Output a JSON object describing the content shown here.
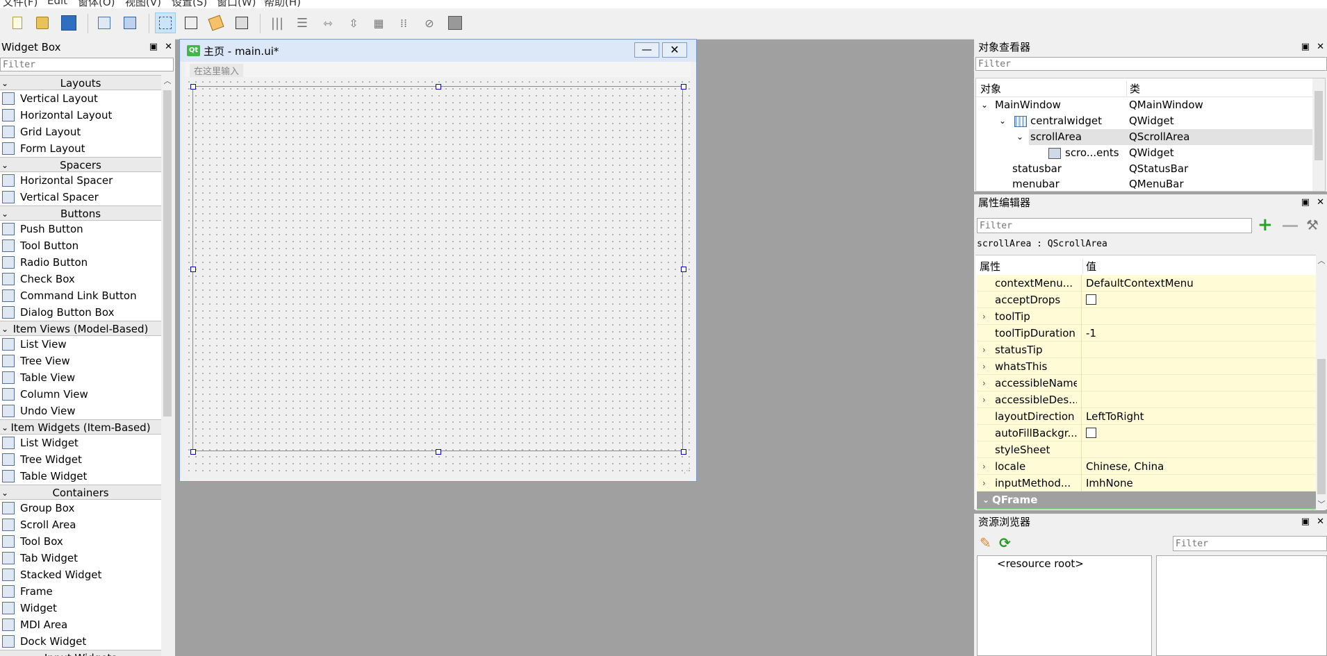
{
  "menu": [
    "文件(F)",
    "Edit",
    "窗体(O)",
    "视图(V)",
    "设置(S)",
    "窗口(W)",
    "帮助(H)"
  ],
  "widget_box": {
    "title": "Widget Box",
    "filter_placeholder": "Filter",
    "categories": [
      {
        "name": "Layouts",
        "items": [
          "Vertical Layout",
          "Horizontal Layout",
          "Grid Layout",
          "Form Layout"
        ]
      },
      {
        "name": "Spacers",
        "items": [
          "Horizontal Spacer",
          "Vertical Spacer"
        ]
      },
      {
        "name": "Buttons",
        "items": [
          "Push Button",
          "Tool Button",
          "Radio Button",
          "Check Box",
          "Command Link Button",
          "Dialog Button Box"
        ]
      },
      {
        "name": "Item Views (Model-Based)",
        "items": [
          "List View",
          "Tree View",
          "Table View",
          "Column View",
          "Undo View"
        ]
      },
      {
        "name": "Item Widgets (Item-Based)",
        "items": [
          "List Widget",
          "Tree Widget",
          "Table Widget"
        ]
      },
      {
        "name": "Containers",
        "items": [
          "Group Box",
          "Scroll Area",
          "Tool Box",
          "Tab Widget",
          "Stacked Widget",
          "Frame",
          "Widget",
          "MDI Area",
          "Dock Widget"
        ]
      }
    ],
    "partial_next": "Input Widgets"
  },
  "form": {
    "title": "主页 - main.ui*",
    "qt_badge": "Qt",
    "menu_placeholder": "在这里输入"
  },
  "object_inspector": {
    "title": "对象查看器",
    "filter_placeholder": "Filter",
    "col_object": "对象",
    "col_class": "类",
    "rows": [
      {
        "name": "MainWindow",
        "cls": "QMainWindow"
      },
      {
        "name": "centralwidget",
        "cls": "QWidget"
      },
      {
        "name": "scrollArea",
        "cls": "QScrollArea"
      },
      {
        "name": "scro...ents",
        "cls": "QWidget"
      },
      {
        "name": "statusbar",
        "cls": "QStatusBar"
      },
      {
        "name": "menubar",
        "cls": "QMenuBar"
      }
    ]
  },
  "property_editor": {
    "title": "属性编辑器",
    "filter_placeholder": "Filter",
    "context": "scrollArea : QScrollArea",
    "col_prop": "属性",
    "col_value": "值",
    "rows": [
      {
        "name": "contextMenu...",
        "value": "DefaultContextMenu"
      },
      {
        "name": "acceptDrops",
        "value": ""
      },
      {
        "name": "toolTip",
        "value": ""
      },
      {
        "name": "toolTipDuration",
        "value": "-1"
      },
      {
        "name": "statusTip",
        "value": ""
      },
      {
        "name": "whatsThis",
        "value": ""
      },
      {
        "name": "accessibleName",
        "value": ""
      },
      {
        "name": "accessibleDes...",
        "value": ""
      },
      {
        "name": "layoutDirection",
        "value": "LeftToRight"
      },
      {
        "name": "autoFillBackgr...",
        "value": ""
      },
      {
        "name": "styleSheet",
        "value": ""
      },
      {
        "name": "locale",
        "value": "Chinese, China"
      },
      {
        "name": "inputMethod...",
        "value": "ImhNone"
      }
    ],
    "section": "QFrame"
  },
  "resource_browser": {
    "title": "资源浏览器",
    "filter_placeholder": "Filter",
    "root": "<resource root>"
  },
  "colors": {
    "accent": "#3c7fb1",
    "prop_bg": "#fffbd6",
    "section_bg": "#a0a0a0"
  }
}
